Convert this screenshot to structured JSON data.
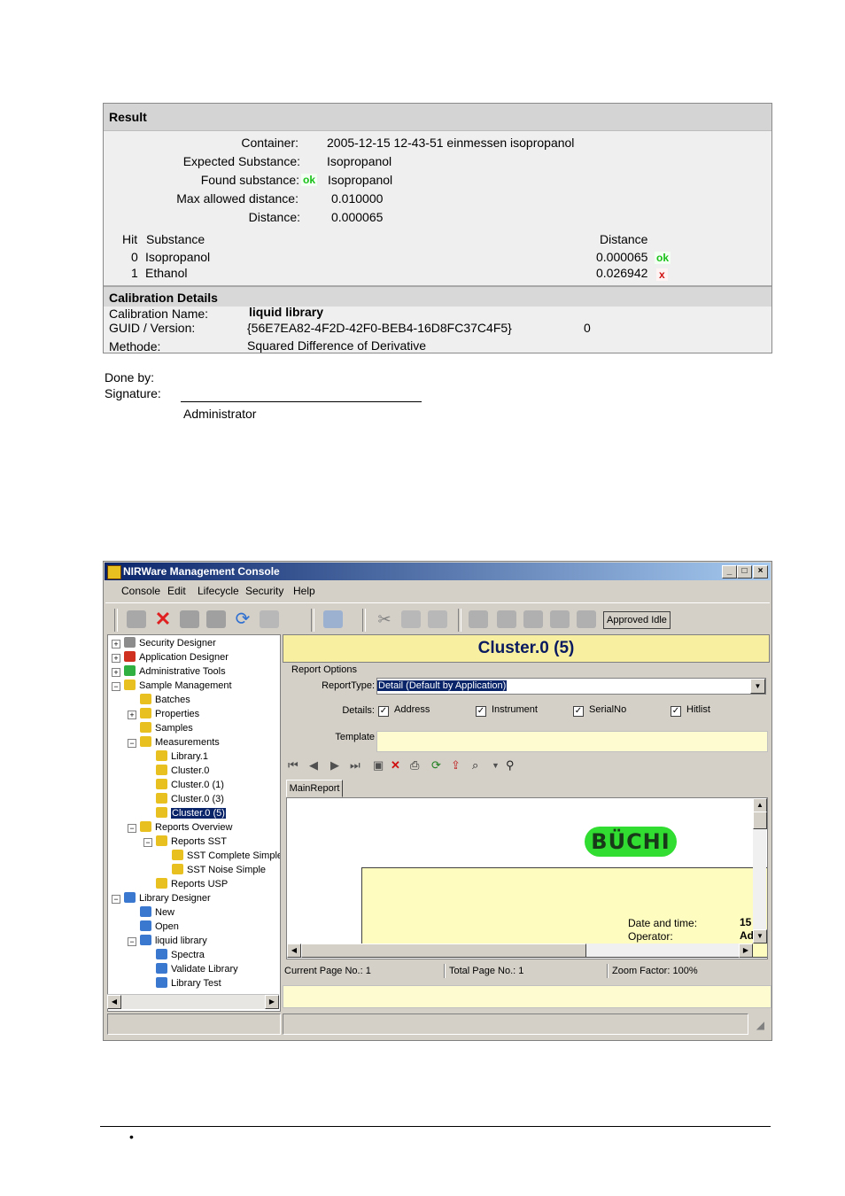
{
  "result": {
    "title": "Result",
    "container_label": "Container:",
    "container_value": "2005-12-15  12-43-51  einmessen isopropanol",
    "expected_label": "Expected Substance:",
    "expected_value": "Isopropanol",
    "found_label": "Found substance:",
    "found_flag": "ok",
    "found_value": "Isopropanol",
    "max_label": "Max allowed distance:",
    "max_value": "0.010000",
    "distance_label": "Distance:",
    "distance_value": "0.000065",
    "hit_header": "Hit",
    "substance_header": "Substance",
    "distance_header": "Distance",
    "hits": [
      {
        "hit": "0",
        "substance": "Isopropanol",
        "distance": "0.000065",
        "flag": "ok"
      },
      {
        "hit": "1",
        "substance": "Ethanol",
        "distance": "0.026942",
        "flag": "x"
      }
    ]
  },
  "calibration": {
    "title": "Calibration Details",
    "name_label": "Calibration Name:",
    "name_value": "liquid library",
    "guid_label": "GUID / Version:",
    "guid_value": "{56E7EA82-4F2D-42F0-BEB4-16D8FC37C4F5}",
    "version_value": "0",
    "method_label": "Methode:",
    "method_value": "Squared Difference of Derivative"
  },
  "signoff": {
    "done_by": "Done by:",
    "signature": "Signature:",
    "name": "Administrator"
  },
  "window": {
    "title": "NIRWare Management Console",
    "min": "_",
    "max": "□",
    "close": "×",
    "menu": [
      "Console",
      "Edit",
      "Lifecycle",
      "Security",
      "Help"
    ],
    "status_text": "Approved Idle",
    "tree": [
      {
        "label": "Security Designer",
        "icon": "gray",
        "level": 0,
        "expander": "+"
      },
      {
        "label": "Application Designer",
        "icon": "red",
        "level": 0,
        "expander": "+"
      },
      {
        "label": "Administrative Tools",
        "icon": "green",
        "level": 0,
        "expander": "+"
      },
      {
        "label": "Sample Management",
        "icon": "yellow",
        "level": 0,
        "expander": "−"
      },
      {
        "label": "Batches",
        "icon": "yellow",
        "level": 1,
        "expander": ""
      },
      {
        "label": "Properties",
        "icon": "yellow",
        "level": 1,
        "expander": "+"
      },
      {
        "label": "Samples",
        "icon": "yellow",
        "level": 1,
        "expander": ""
      },
      {
        "label": "Measurements",
        "icon": "yellow",
        "level": 1,
        "expander": "−"
      },
      {
        "label": "Library.1",
        "icon": "yellow",
        "level": 2,
        "expander": ""
      },
      {
        "label": "Cluster.0",
        "icon": "yellow",
        "level": 2,
        "expander": ""
      },
      {
        "label": "Cluster.0 (1)",
        "icon": "yellow",
        "level": 2,
        "expander": ""
      },
      {
        "label": "Cluster.0 (3)",
        "icon": "yellow",
        "level": 2,
        "expander": ""
      },
      {
        "label": "Cluster.0 (5)",
        "icon": "yellow",
        "level": 2,
        "expander": "",
        "selected": true
      },
      {
        "label": "Reports Overview",
        "icon": "yellow",
        "level": 1,
        "expander": "−"
      },
      {
        "label": "Reports SST",
        "icon": "yellow",
        "level": 2,
        "expander": "−"
      },
      {
        "label": "SST Complete Simple",
        "icon": "yellow",
        "level": 3,
        "expander": ""
      },
      {
        "label": "SST Noise Simple",
        "icon": "yellow",
        "level": 3,
        "expander": ""
      },
      {
        "label": "Reports USP",
        "icon": "yellow",
        "level": 2,
        "expander": ""
      },
      {
        "label": "Library Designer",
        "icon": "blue",
        "level": 0,
        "expander": "−"
      },
      {
        "label": "New",
        "icon": "blue",
        "level": 1,
        "expander": ""
      },
      {
        "label": "Open",
        "icon": "blue",
        "level": 1,
        "expander": ""
      },
      {
        "label": "liquid library",
        "icon": "blue",
        "level": 1,
        "expander": "−"
      },
      {
        "label": "Spectra",
        "icon": "blue",
        "level": 2,
        "expander": ""
      },
      {
        "label": "Validate Library",
        "icon": "blue",
        "level": 2,
        "expander": ""
      },
      {
        "label": "Library Test",
        "icon": "blue",
        "level": 2,
        "expander": ""
      }
    ],
    "cluster_title": "Cluster.0 (5)",
    "report_options": "Report Options",
    "report_type_label": "ReportType:",
    "report_type_value": "Detail (Default by Application)",
    "details_label": "Details:",
    "details": [
      "Address",
      "Instrument",
      "SerialNo",
      "Hitlist"
    ],
    "template_label": "Template",
    "tab_label": "MainReport",
    "logo_text": "BÜCHI",
    "date_label": "Date and time:",
    "date_value": "15",
    "operator_label": "Operator:",
    "operator_value": "Ad",
    "current_page": "Current Page No.: 1",
    "total_page": "Total Page No.: 1",
    "zoom": "Zoom Factor: 100%"
  },
  "footer": {
    "bullet": "•"
  }
}
